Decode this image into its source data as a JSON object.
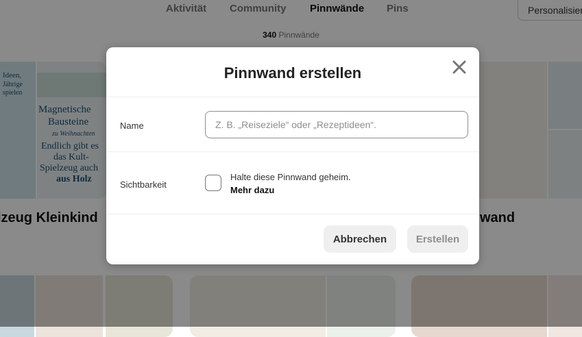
{
  "header": {
    "tabs": [
      {
        "label": "Aktivität"
      },
      {
        "label": "Community"
      },
      {
        "label": "Pinnwände"
      },
      {
        "label": "Pins"
      }
    ],
    "personalize_label": "Personalisieren",
    "board_count_number": "340",
    "board_count_label": "Pinnwände"
  },
  "boards": [
    {
      "title": "lzeug Kleinkind",
      "image_text": {
        "line1": "Ideen,",
        "line2": "Jährige",
        "line3": "spielen",
        "line4": "Magnetische",
        "line5": "Bausteine",
        "line6": "zu Weihnachten",
        "line7": "Endlich gibt es",
        "line8": "das Kult-",
        "line9": "Spielzeug auch",
        "line10": "aus Holz"
      }
    },
    {
      "title": "wand"
    }
  ],
  "modal": {
    "title": "Pinnwand erstellen",
    "name_label": "Name",
    "name_placeholder": "Z. B. „Reiseziele“ oder „Rezeptideen“.",
    "name_value": "",
    "visibility_label": "Sichtbarkeit",
    "secret_text": "Halte diese Pinnwand geheim.",
    "learn_more": "Mehr dazu",
    "secret_checked": false,
    "cancel_label": "Abbrechen",
    "create_label": "Erstellen"
  },
  "colors": {
    "overlay": "rgba(0,0,0,0.46)",
    "button_bg": "#efefef",
    "disabled_text": "#8e8e8e"
  }
}
